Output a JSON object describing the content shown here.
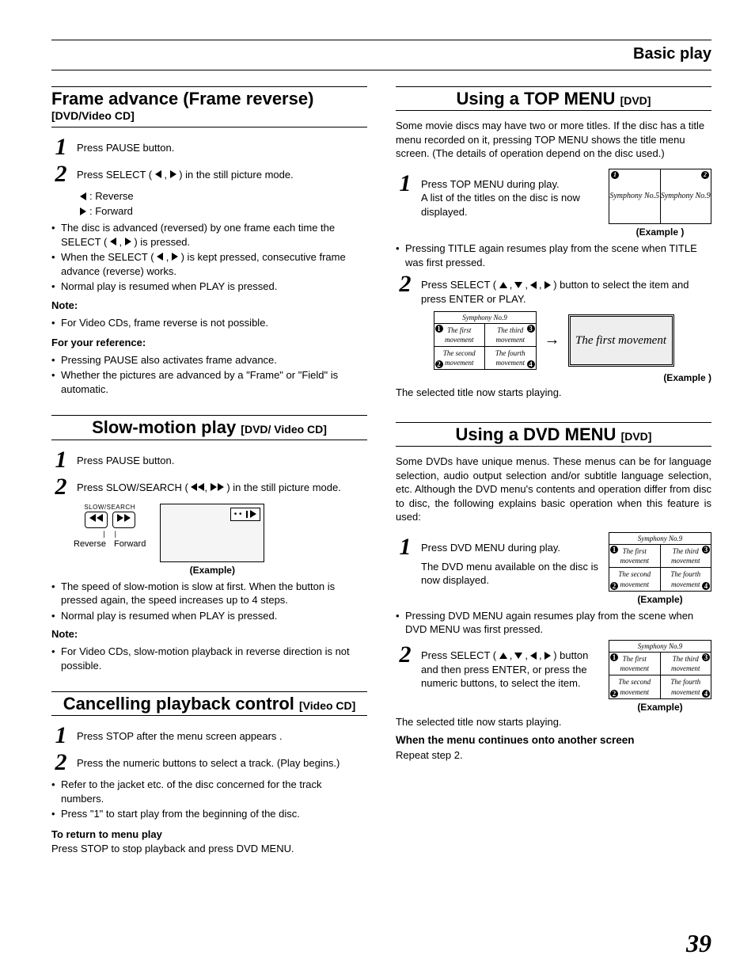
{
  "header": "Basic play",
  "page_number": "39",
  "left": {
    "s1": {
      "title": "Frame advance (Frame reverse)",
      "tag": "[DVD/Video CD]",
      "step1": "Press PAUSE button.",
      "step2_a": "Press SELECT ( ",
      "step2_b": " , ",
      "step2_c": " ) in the still picture mode.",
      "rev": " : Reverse",
      "fwd": " : Forward",
      "b1a": "The disc is advanced (reversed) by one frame each time the SELECT ( ",
      "b1b": " , ",
      "b1c": " ) is pressed.",
      "b2a": "When the SELECT ( ",
      "b2b": " , ",
      "b2c": " ) is kept pressed, consecutive frame advance (reverse) works.",
      "b3": "Normal play is resumed when PLAY is pressed.",
      "note_h": "Note:",
      "note1": "For Video CDs, frame reverse is not possible.",
      "ref_h": "For your reference:",
      "ref1": "Pressing PAUSE also activates frame advance.",
      "ref2": "Whether the pictures are advanced by a \"Frame\" or \"Field\" is automatic."
    },
    "s2": {
      "title": "Slow-motion play ",
      "tag": "[DVD/ Video CD]",
      "step1": "Press PAUSE button.",
      "step2_a": "Press SLOW/SEARCH ( ",
      "step2_b": ", ",
      "step2_c": " ) in the still picture mode.",
      "slow_label": "SLOW/SEARCH",
      "rev": "Reverse",
      "fwd": "Forward",
      "ex": "(Example)",
      "b1": "The speed of slow-motion is slow at first. When the button is pressed again, the speed increases up to 4 steps.",
      "b2": "Normal play is resumed when PLAY is pressed.",
      "note_h": "Note:",
      "note1": "For Video CDs, slow-motion playback in reverse direction is not possible."
    },
    "s3": {
      "title": "Cancelling playback control ",
      "tag": "[Video CD]",
      "step1": "Press STOP after the menu screen appears .",
      "step2": "Press the numeric buttons to select a track. (Play begins.)",
      "b1": "Refer to the jacket etc. of the disc concerned for the track numbers.",
      "b2": "Press \"1\" to start play from the beginning of the disc.",
      "ret_h": "To return to menu play",
      "ret": "Press STOP to stop playback and press DVD MENU."
    }
  },
  "right": {
    "s1": {
      "title": "Using a TOP MENU ",
      "tag": "[DVD]",
      "intro": "Some movie discs may have two or more titles. If the disc has a title menu recorded on it, pressing TOP MENU shows the title menu screen. (The details of operation depend on the disc used.)",
      "step1a": "Press TOP MENU during play.",
      "step1b": "A list of the titles on the disc is now displayed.",
      "sym5": "Symphony No.5",
      "sym9": "Symphony No.9",
      "ex1": "(Example )",
      "b1": "Pressing TITLE again resumes play from the scene when TITLE was first pressed.",
      "step2_a": "Press SELECT ( ",
      "step2_b": " ) button to select the item and press ENTER or PLAY.",
      "gridtitle": "Symphony  No.9",
      "c1": "The first movement",
      "c2": "The third movement",
      "c3": "The second movement",
      "c4": "The fourth movement",
      "big": "The first movement",
      "ex2": "(Example )",
      "after": "The selected title now starts playing."
    },
    "s2": {
      "title": "Using a DVD MENU ",
      "tag": "[DVD]",
      "intro": "Some DVDs have unique menus. These menus can be for language selection, audio output selection and/or subtitle language selection, etc. Although the DVD menu's contents and operation differ from disc to disc, the following explains basic operation when this feature is used:",
      "step1a": "Press DVD MENU during play.",
      "step1b": "The DVD menu available on the disc is now displayed.",
      "ex1": "(Example)",
      "b1": "Pressing DVD MENU again resumes play from the scene when DVD MENU was first pressed.",
      "step2_a": "Press SELECT ( ",
      "step2_b": " ) button and then press ENTER, or press the numeric buttons, to select the item.",
      "ex2": "(Example)",
      "after": "The selected title now starts playing.",
      "cont_h": "When the menu continues onto another screen",
      "cont": "Repeat step 2."
    }
  }
}
